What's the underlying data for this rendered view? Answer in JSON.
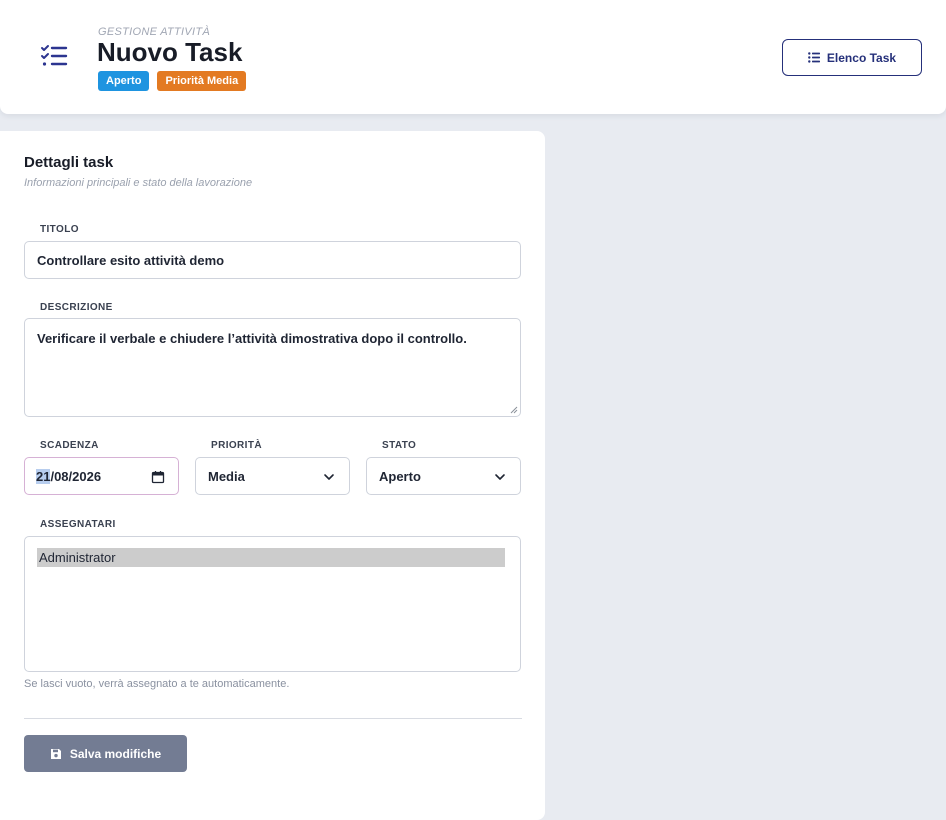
{
  "header": {
    "eyebrow": "GESTIONE ATTIVITÀ",
    "title": "Nuovo Task",
    "badges": [
      {
        "label": "Aperto",
        "color": "#1e94e0"
      },
      {
        "label": "Priorità Media",
        "color": "#e37a22"
      }
    ],
    "list_button": {
      "label": "Elenco Task",
      "icon": "list-icon"
    },
    "icon": "task-list-icon",
    "accent": "#25307a"
  },
  "card": {
    "title": "Dettagli task",
    "subtitle": "Informazioni principali e stato della lavorazione"
  },
  "form": {
    "title": {
      "label": "TITOLO",
      "value": "Controllare esito attività demo"
    },
    "description": {
      "label": "DESCRIZIONE",
      "value": "Verificare il verbale e chiudere l’attività dimostrativa dopo il controllo."
    },
    "due_date": {
      "label": "SCADENZA",
      "day": "21",
      "rest": "/08/2026",
      "icon": "calendar-icon"
    },
    "priority": {
      "label": "PRIORITÀ",
      "value": "Media"
    },
    "status": {
      "label": "STATO",
      "value": "Aperto"
    },
    "assignees": {
      "label": "ASSEGNATARI",
      "options": [
        "Administrator"
      ],
      "selected": "Administrator"
    },
    "help_text": "Se lasci vuoto, verrà assegnato a te automaticamente."
  },
  "actions": {
    "save": {
      "label": "Salva modifiche",
      "icon": "floppy-disk-icon",
      "color": "#737c93"
    }
  }
}
